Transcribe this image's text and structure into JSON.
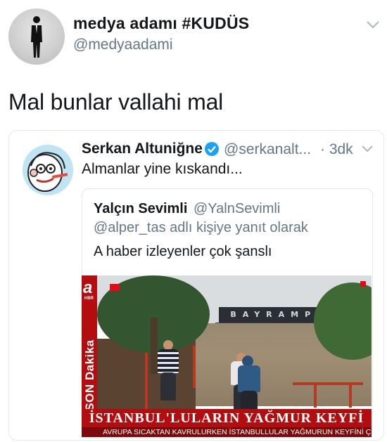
{
  "tweet": {
    "author_name": "medya adamı #KUDÜS",
    "author_handle": "@medyaadami",
    "text": "Mal bunlar vallahi mal"
  },
  "quoted_tweet": {
    "author_name": "Serkan Altuniğne",
    "author_handle": "@serkanalt...",
    "time": "· 3dk",
    "text": "Almanlar yine kıskandı...",
    "verified_color": "#1da1f2"
  },
  "nested_tweet": {
    "author_name": "Yalçın Sevimli",
    "author_handle": "@YalnSevimli",
    "reply_context": "@alper_tas adlı kişiye yanıt olarak",
    "text": "A haber izleyenler çok şanslı"
  },
  "news_image": {
    "logo": "a",
    "logo_sub": "HBR",
    "side_label": "SON Dakika",
    "sign_text": "BAYRAMPA",
    "headline": "İSTANBUL'LULARIN YAĞMUR KEYFİ",
    "ticker": "AVRUPA SICAKTAN KAVRULURKEN İSTANBULLULAR YAĞMURUN KEYFİNİ ÇIK",
    "brand_color": "#b30d10"
  },
  "icons": [
    "user-avatar",
    "chevron-down-icon",
    "verified-badge-icon",
    "quoted-user-avatar"
  ]
}
